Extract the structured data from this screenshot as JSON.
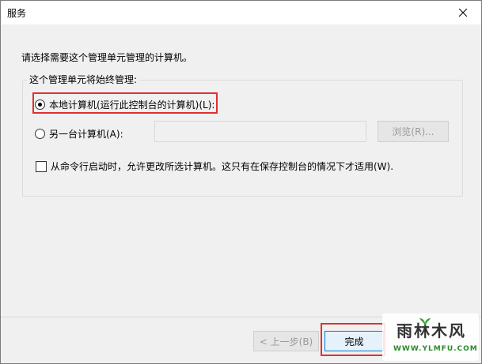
{
  "window": {
    "title": "服务"
  },
  "prompt": "请选择需要这个管理单元管理的计算机。",
  "group": {
    "caption": "这个管理单元将始终管理:",
    "local_option_label": "本地计算机(运行此控制台的计算机)(L):",
    "local_option_checked": true,
    "other_option_label": "另一台计算机(A):",
    "other_option_checked": false,
    "other_computer_value": "",
    "browse_label": "浏览(R)...",
    "allow_change_label": "从命令行启动时，允许更改所选计算机。这只有在保存控制台的情况下才适用(W).",
    "allow_change_checked": false
  },
  "footer": {
    "back_label": "< 上一步(B)",
    "finish_label": "完成"
  },
  "watermark": {
    "site": "雨林木风",
    "url": "WWW.YLMFU.COM"
  },
  "colors": {
    "highlight": "#e03030",
    "dialog_bg": "#f0f0f0",
    "focus_border": "#0078d7"
  }
}
